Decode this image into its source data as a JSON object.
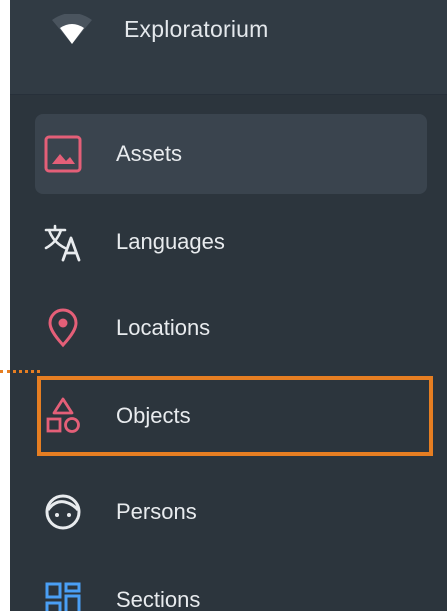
{
  "app": {
    "title": "Exploratorium",
    "logo_icon": "wifi-logo-icon"
  },
  "sidebar": {
    "items": [
      {
        "label": "Assets",
        "icon": "image-icon",
        "active": true
      },
      {
        "label": "Languages",
        "icon": "translate-icon",
        "active": false
      },
      {
        "label": "Locations",
        "icon": "map-pin-icon",
        "active": false
      },
      {
        "label": "Objects",
        "icon": "shapes-icon",
        "active": false,
        "highlighted": true
      },
      {
        "label": "Persons",
        "icon": "face-icon",
        "active": false
      },
      {
        "label": "Sections",
        "icon": "grid-layout-icon",
        "active": false
      }
    ]
  },
  "colors": {
    "sidebar_bg": "#2c353d",
    "header_bg": "#313b44",
    "active_item_bg": "#3a444e",
    "icon_accent": "#e45f78",
    "icon_light": "#e8ebee",
    "icon_blue": "#4a9ff5",
    "highlight_border": "#e67e22",
    "text": "#e8ebee"
  }
}
